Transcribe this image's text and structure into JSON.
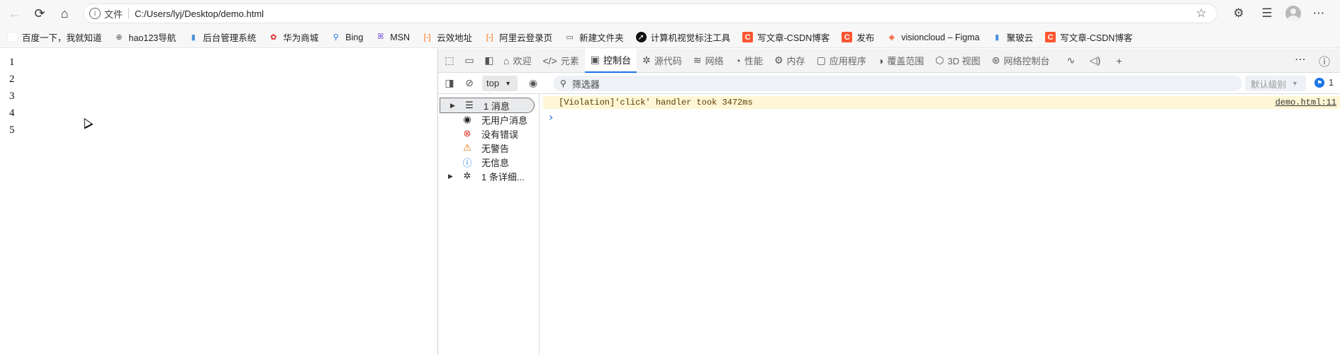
{
  "browser": {
    "address": {
      "protocol_label": "文件",
      "url": "C:/Users/lyj/Desktop/demo.html"
    }
  },
  "bookmarks": [
    {
      "label": "百度一下，我就知道",
      "icon": "blank-icon",
      "color": "#ffffff"
    },
    {
      "label": "hao123导航",
      "icon": "globe-icon",
      "color": "#555555"
    },
    {
      "label": "后台管理系统",
      "icon": "bookmark-icon",
      "color": "#4a90d9"
    },
    {
      "label": "华为商城",
      "icon": "huawei-icon",
      "color": "#e02020"
    },
    {
      "label": "Bing",
      "icon": "search-icon",
      "color": "#1a73e8"
    },
    {
      "label": "MSN",
      "icon": "butterfly-icon",
      "color": "#7a4fd6"
    },
    {
      "label": "云效地址",
      "icon": "bracket-icon",
      "color": "#ff6a00"
    },
    {
      "label": "阿里云登录页",
      "icon": "bracket-icon",
      "color": "#ff6a00"
    },
    {
      "label": "新建文件夹",
      "icon": "folder-icon",
      "color": "#555555"
    },
    {
      "label": "计算机视觉标注工具",
      "icon": "arrow-circle-icon",
      "color": "#111111"
    },
    {
      "label": "写文章-CSDN博客",
      "icon": "csdn-icon",
      "color": "#fc5531"
    },
    {
      "label": "发布",
      "icon": "csdn-icon",
      "color": "#fc5531"
    },
    {
      "label": "visioncloud – Figma",
      "icon": "figma-icon",
      "color": "#f24e1e"
    },
    {
      "label": "聚玻云",
      "icon": "bookmark-icon",
      "color": "#4a90d9"
    },
    {
      "label": "写文章-CSDN博客",
      "icon": "csdn-icon",
      "color": "#fc5531"
    }
  ],
  "page": {
    "lines": [
      "1",
      "2",
      "3",
      "4",
      "5"
    ]
  },
  "devtools": {
    "tabs": [
      {
        "label": "欢迎",
        "icon": "home-icon",
        "active": false
      },
      {
        "label": "元素",
        "icon": "code-icon",
        "active": false
      },
      {
        "label": "控制台",
        "icon": "console-icon",
        "active": true
      },
      {
        "label": "源代码",
        "icon": "bug-icon",
        "active": false
      },
      {
        "label": "网络",
        "icon": "wifi-icon",
        "active": false
      },
      {
        "label": "性能",
        "icon": "gauge-icon",
        "active": false
      },
      {
        "label": "内存",
        "icon": "memory-icon",
        "active": false
      },
      {
        "label": "应用程序",
        "icon": "app-icon",
        "active": false
      },
      {
        "label": "覆盖范围",
        "icon": "coverage-icon",
        "active": false
      },
      {
        "label": "3D 视图",
        "icon": "cube-icon",
        "active": false
      },
      {
        "label": "网络控制台",
        "icon": "network-console-icon",
        "active": false
      }
    ],
    "filterbar": {
      "context": "top",
      "filter_placeholder": "筛选器",
      "level": "默认级别",
      "issues_count": "1",
      "issues_extra": "1"
    },
    "sidebar": [
      {
        "label": "1 消息",
        "icon": "list-icon",
        "expandable": true,
        "selected": true
      },
      {
        "label": "无用户消息",
        "icon": "user-icon",
        "expandable": false,
        "selected": false
      },
      {
        "label": "没有错误",
        "icon": "error-icon",
        "expandable": false,
        "selected": false
      },
      {
        "label": "无警告",
        "icon": "warning-icon",
        "expandable": false,
        "selected": false
      },
      {
        "label": "无信息",
        "icon": "info-icon",
        "expandable": false,
        "selected": false
      },
      {
        "label": "1 条详细...",
        "icon": "bug-icon",
        "expandable": true,
        "selected": false
      }
    ],
    "console": {
      "messages": [
        {
          "text": "[Violation]'click' handler took 3472ms",
          "source": "demo.html:11",
          "level": "violation"
        }
      ],
      "prompt_symbol": "›"
    }
  }
}
